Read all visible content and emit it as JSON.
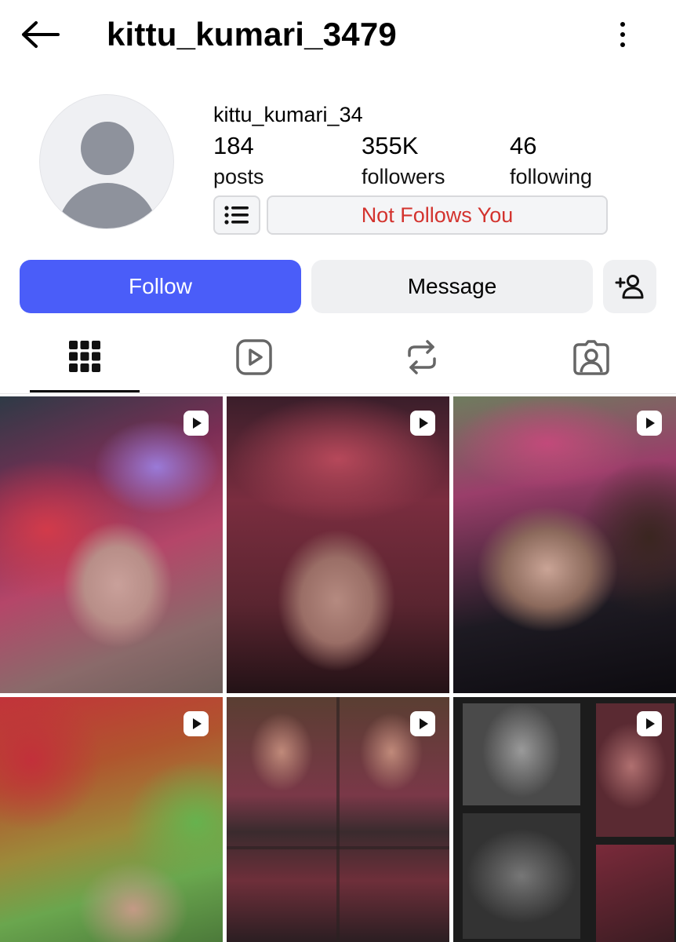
{
  "header": {
    "title": "kittu_kumari_3479"
  },
  "profile": {
    "handle": "kittu_kumari_34",
    "stats": {
      "posts_count": "184",
      "posts_label": "posts",
      "followers_count": "355K",
      "followers_label": "followers",
      "following_count": "46",
      "following_label": "following"
    },
    "relationship_badge": "Not Follows You"
  },
  "actions": {
    "follow_label": "Follow",
    "message_label": "Message"
  },
  "tabs": [
    {
      "icon": "grid-icon",
      "active": true
    },
    {
      "icon": "reels-icon",
      "active": false
    },
    {
      "icon": "reposts-icon",
      "active": false
    },
    {
      "icon": "tagged-icon",
      "active": false
    }
  ],
  "posts": [
    {
      "type": "reel"
    },
    {
      "type": "reel"
    },
    {
      "type": "reel"
    },
    {
      "type": "reel"
    },
    {
      "type": "reel"
    },
    {
      "type": "reel"
    }
  ],
  "colors": {
    "follow_button": "#4a5df9",
    "secondary_button": "#eff0f2",
    "badge_text": "#d3332e"
  }
}
